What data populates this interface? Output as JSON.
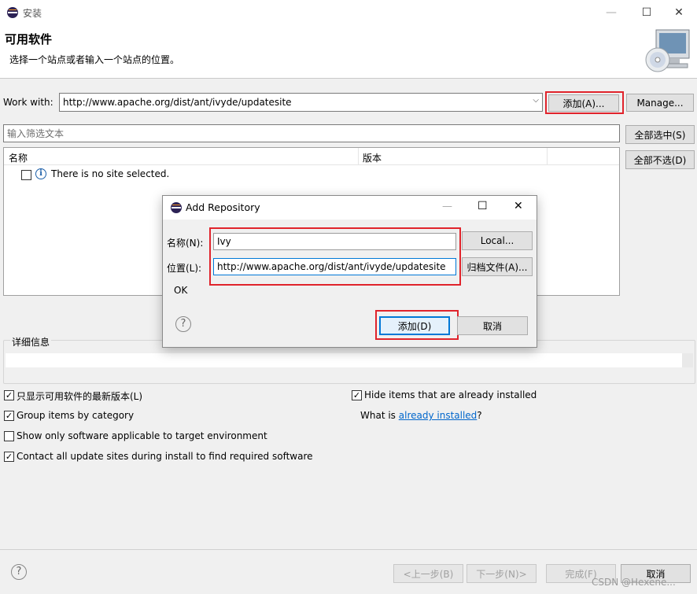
{
  "window": {
    "title": "安装",
    "min_glyph": "—",
    "max_glyph": "☐",
    "close_glyph": "✕"
  },
  "header": {
    "title": "可用软件",
    "subtitle": "选择一个站点或者输入一个站点的位置。"
  },
  "work_with": {
    "label": "Work with:",
    "value": "http://www.apache.org/dist/ant/ivyde/updatesite",
    "add_button": "添加(A)...",
    "manage_button": "Manage..."
  },
  "filter": {
    "placeholder": "输入筛选文本"
  },
  "side_buttons": {
    "select_all": "全部选中(S)",
    "deselect_all": "全部不选(D)"
  },
  "table": {
    "columns": [
      "名称",
      "版本"
    ],
    "empty_message": "There is no site selected."
  },
  "details": {
    "label": "详细信息"
  },
  "options": {
    "latest_only": "只显示可用软件的最新版本(L)",
    "group_by_category": "Group items by category",
    "target_env_only": "Show only software applicable to target environment",
    "contact_all_sites": "Contact all update sites during install to find required software",
    "hide_installed": "Hide items that are already installed",
    "what_is_prefix": "What is ",
    "what_is_link": "already installed",
    "what_is_suffix": "?"
  },
  "footer": {
    "back": "<上一步(B)",
    "next": "下一步(N)>",
    "finish": "完成(F)",
    "cancel": "取消",
    "watermark": "CSDN @Hexene..."
  },
  "dialog": {
    "title": "Add Repository",
    "name_label": "名称(N):",
    "name_value": "Ivy",
    "local_button": "Local...",
    "location_label": "位置(L):",
    "location_value": "http://www.apache.org/dist/ant/ivyde/updatesite",
    "archive_button": "归档文件(A)...",
    "status": "OK",
    "add_button": "添加(D)",
    "cancel_button": "取消"
  },
  "colors": {
    "highlight_red": "#e0242c",
    "focus_blue": "#0078d7",
    "link_blue": "#0066cc"
  }
}
